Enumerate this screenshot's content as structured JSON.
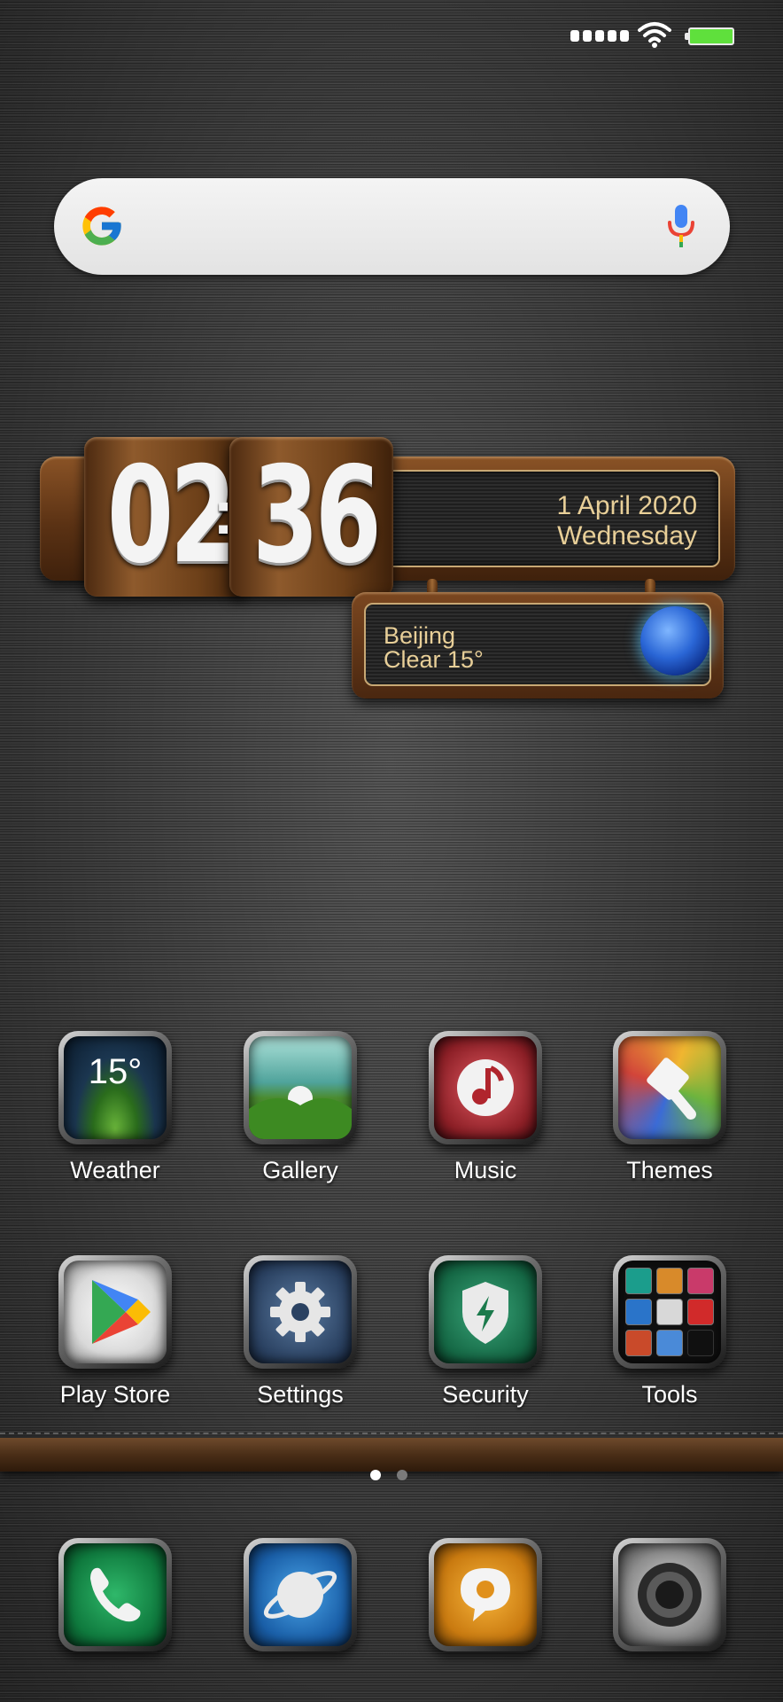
{
  "status_bar": {
    "signal_icon": "signal-bars-icon",
    "wifi_icon": "wifi-icon",
    "battery_icon": "battery-full-icon",
    "battery_color": "#5fe03c"
  },
  "search": {
    "logo_icon": "google-logo-icon",
    "mic_icon": "microphone-icon"
  },
  "clock": {
    "hours": "02",
    "minutes": "36",
    "separator": ":",
    "date_line": "1 April 2020",
    "weekday": "Wednesday",
    "city": "Beijing",
    "condition": "Clear 15°",
    "moon_icon": "moon-globe-icon",
    "text_color": "#e8cf98"
  },
  "apps_row1": [
    {
      "label": "Weather",
      "icon": "weather-icon",
      "overlay": "15°"
    },
    {
      "label": "Gallery",
      "icon": "gallery-icon"
    },
    {
      "label": "Music",
      "icon": "music-note-icon"
    },
    {
      "label": "Themes",
      "icon": "paintbrush-icon"
    }
  ],
  "apps_row2": [
    {
      "label": "Play Store",
      "icon": "play-store-icon"
    },
    {
      "label": "Settings",
      "icon": "gear-icon"
    },
    {
      "label": "Security",
      "icon": "shield-bolt-icon"
    },
    {
      "label": "Tools",
      "icon": "tools-folder-icon"
    }
  ],
  "pager": {
    "pages": 2,
    "active": 1
  },
  "dock": [
    {
      "icon": "phone-icon"
    },
    {
      "icon": "browser-planet-icon"
    },
    {
      "icon": "message-bubble-icon"
    },
    {
      "icon": "camera-lens-icon"
    }
  ]
}
